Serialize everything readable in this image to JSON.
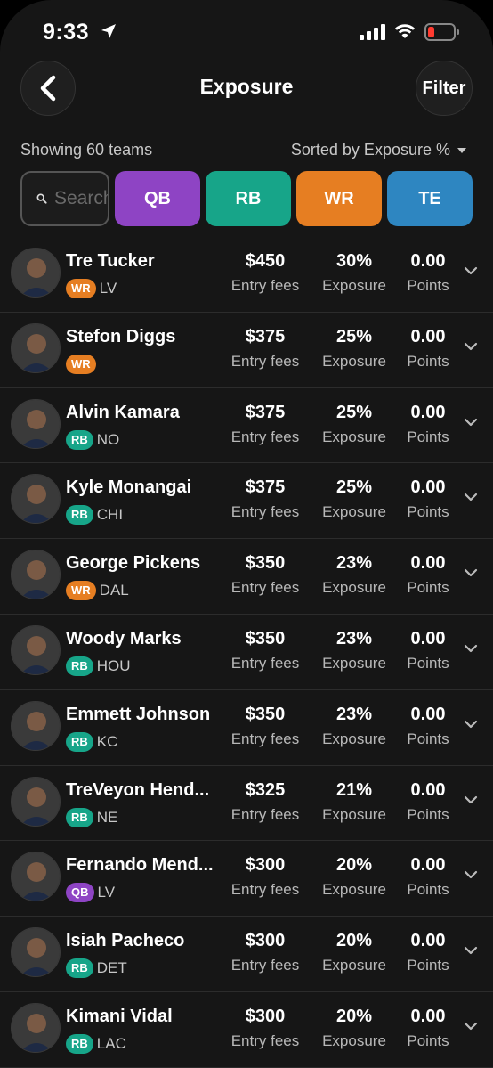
{
  "status_bar": {
    "time": "9:33"
  },
  "header": {
    "title": "Exposure",
    "filter_label": "Filter"
  },
  "meta": {
    "showing": "Showing 60 teams",
    "sorted": "Sorted by Exposure %"
  },
  "search": {
    "placeholder": "Search"
  },
  "positions": [
    {
      "label": "QB",
      "color": "#8e44c4"
    },
    {
      "label": "RB",
      "color": "#17a589"
    },
    {
      "label": "WR",
      "color": "#e67e22"
    },
    {
      "label": "TE",
      "color": "#2e86c1"
    }
  ],
  "stat_labels": {
    "fees": "Entry fees",
    "exposure": "Exposure",
    "points": "Points"
  },
  "players": [
    {
      "name": "Tre Tucker",
      "pos": "WR",
      "team": "LV",
      "fees": "$450",
      "exposure": "30%",
      "points": "0.00"
    },
    {
      "name": "Stefon Diggs",
      "pos": "WR",
      "team": "",
      "fees": "$375",
      "exposure": "25%",
      "points": "0.00"
    },
    {
      "name": "Alvin Kamara",
      "pos": "RB",
      "team": "NO",
      "fees": "$375",
      "exposure": "25%",
      "points": "0.00"
    },
    {
      "name": "Kyle Monangai",
      "pos": "RB",
      "team": "CHI",
      "fees": "$375",
      "exposure": "25%",
      "points": "0.00"
    },
    {
      "name": "George Pickens",
      "pos": "WR",
      "team": "DAL",
      "fees": "$350",
      "exposure": "23%",
      "points": "0.00"
    },
    {
      "name": "Woody Marks",
      "pos": "RB",
      "team": "HOU",
      "fees": "$350",
      "exposure": "23%",
      "points": "0.00"
    },
    {
      "name": "Emmett Johnson",
      "pos": "RB",
      "team": "KC",
      "fees": "$350",
      "exposure": "23%",
      "points": "0.00"
    },
    {
      "name": "TreVeyon Hend...",
      "pos": "RB",
      "team": "NE",
      "fees": "$325",
      "exposure": "21%",
      "points": "0.00"
    },
    {
      "name": "Fernando Mend...",
      "pos": "QB",
      "team": "LV",
      "fees": "$300",
      "exposure": "20%",
      "points": "0.00"
    },
    {
      "name": "Isiah Pacheco",
      "pos": "RB",
      "team": "DET",
      "fees": "$300",
      "exposure": "20%",
      "points": "0.00"
    },
    {
      "name": "Kimani Vidal",
      "pos": "RB",
      "team": "LAC",
      "fees": "$300",
      "exposure": "20%",
      "points": "0.00"
    }
  ]
}
